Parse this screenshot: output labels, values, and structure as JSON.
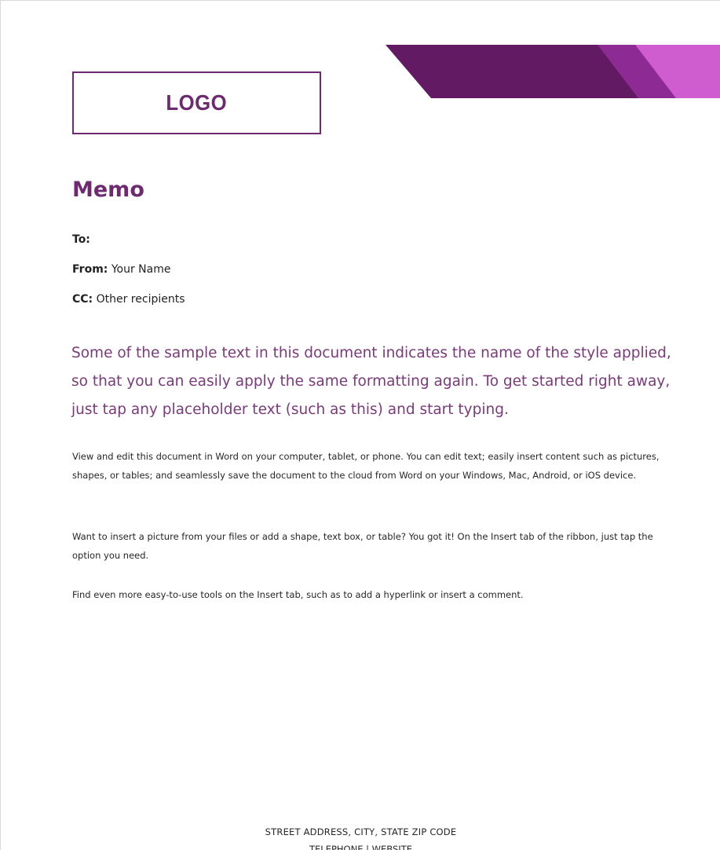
{
  "colors": {
    "accent": "#6e2a6f",
    "intro_text": "#7a3a7b",
    "banner_dark": "#621a63",
    "banner_mid": "#8e2a93",
    "banner_light": "#cf5dcf"
  },
  "logo": {
    "label": "LOGO"
  },
  "memo": {
    "title": "Memo",
    "to_label": "To:",
    "to_value": "",
    "from_label": "From:",
    "from_value": "Your Name",
    "cc_label": "CC:",
    "cc_value": "Other recipients"
  },
  "intro": "Some of the sample text in this document indicates the name of the style applied, so that you can easily apply the same formatting again. To get started right away, just tap any placeholder text (such as this) and start typing.",
  "body": [
    "View and edit this document in Word on your computer, tablet, or phone. You can edit text; easily insert content such as pictures, shapes, or tables; and seamlessly save the document to the cloud from Word on your Windows, Mac, Android, or iOS device.",
    "Want to insert a picture from your files or add a shape, text box, or table? You got it! On the Insert tab of the ribbon, just tap the option you need.",
    "Find even more easy-to-use tools on the Insert tab, such as to add a hyperlink or insert a comment."
  ],
  "footer": {
    "address": "STREET ADDRESS, CITY, STATE  ZIP CODE",
    "contact": "TELEPHONE | WEBSITE"
  }
}
